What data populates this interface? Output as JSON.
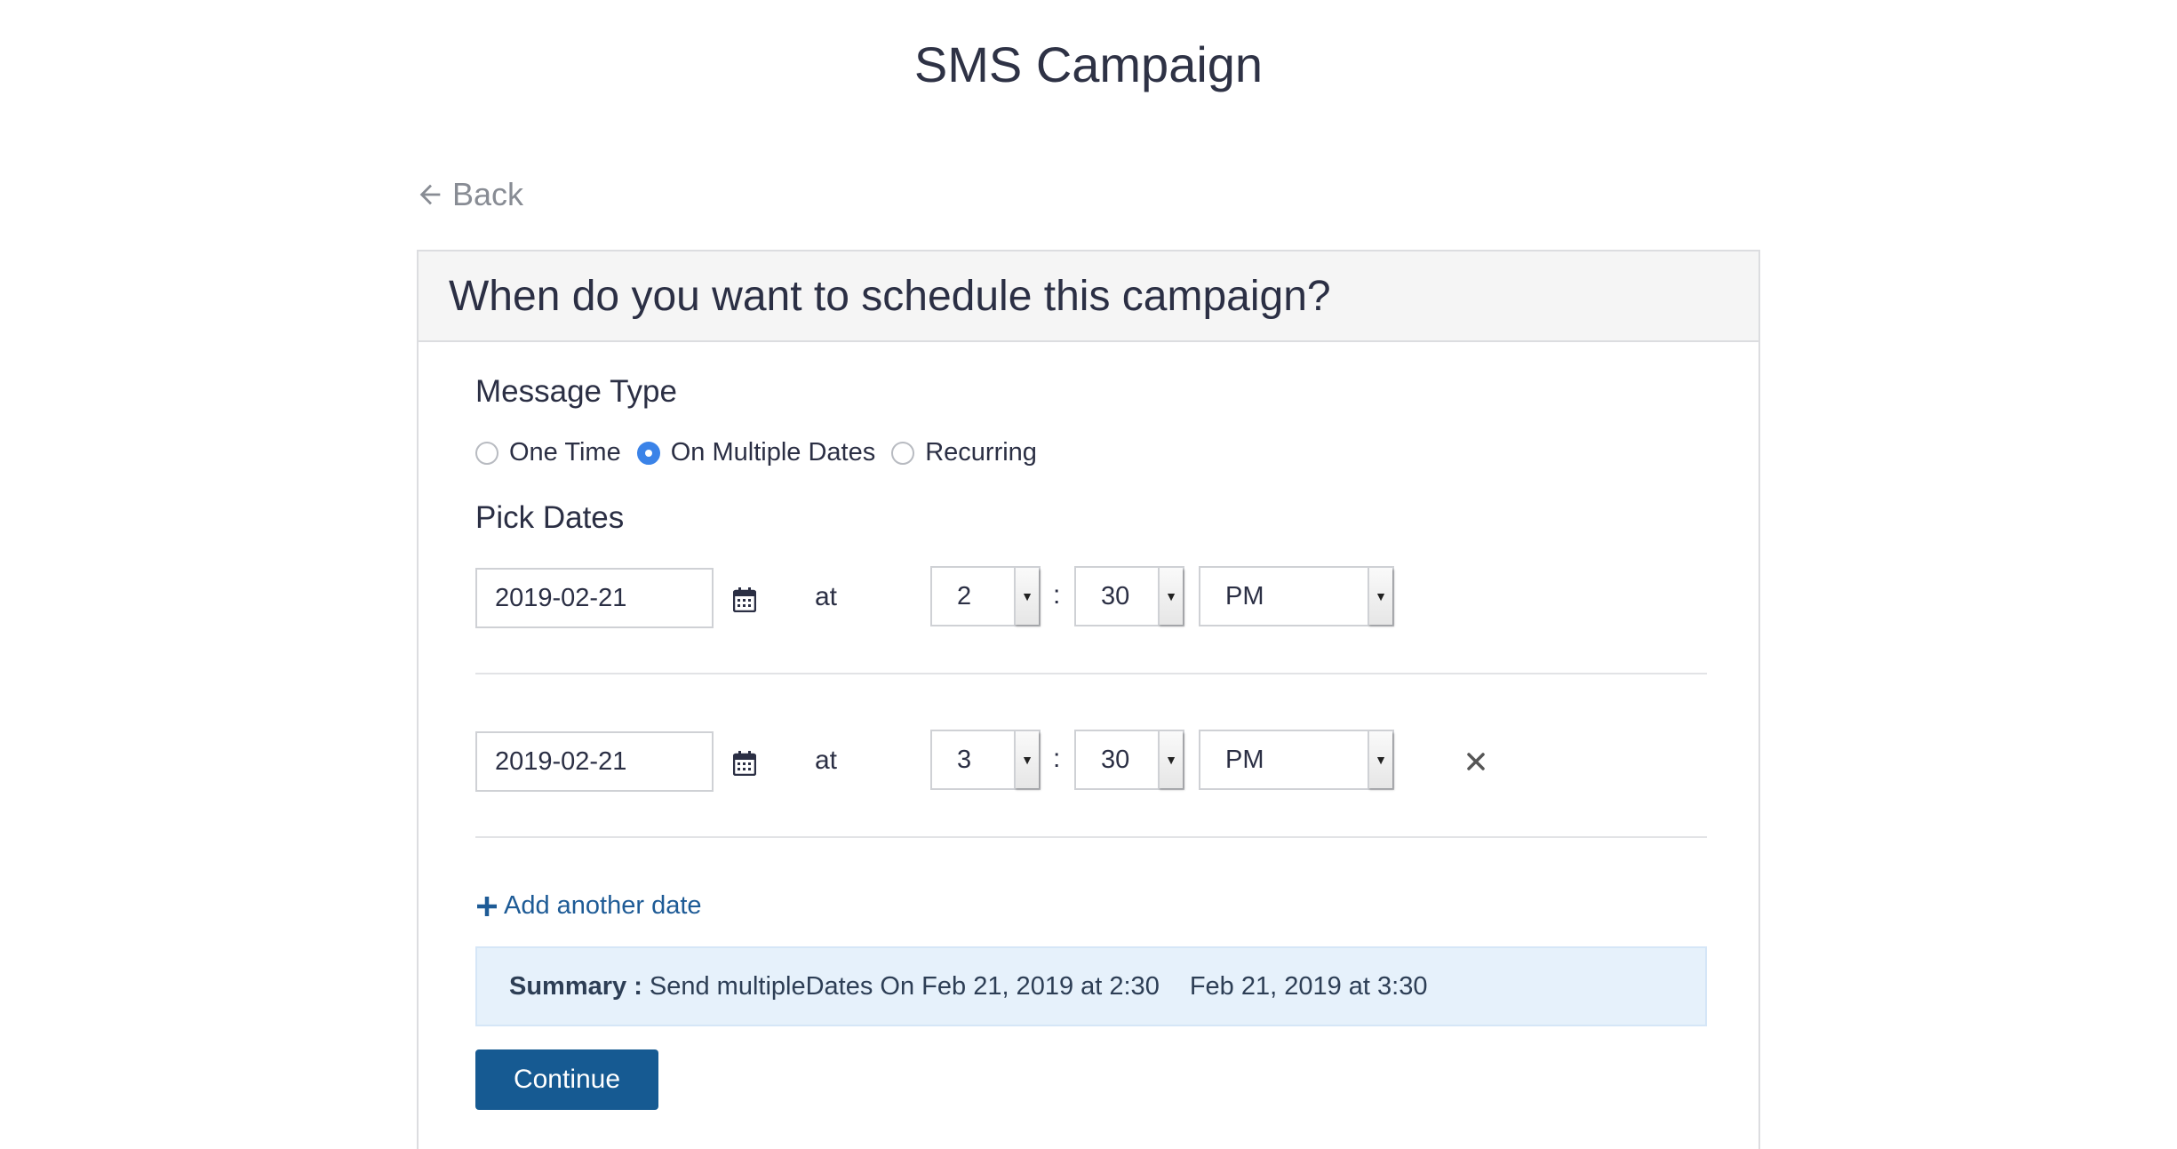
{
  "page": {
    "title": "SMS Campaign",
    "back_label": "Back"
  },
  "card": {
    "heading": "When do you want to schedule this campaign?"
  },
  "message_type": {
    "label": "Message Type",
    "options": [
      {
        "label": "One Time",
        "checked": false
      },
      {
        "label": "On Multiple Dates",
        "checked": true
      },
      {
        "label": "Recurring",
        "checked": false
      }
    ]
  },
  "pick_dates": {
    "label": "Pick Dates",
    "at_label": "at",
    "colon": ":",
    "rows": [
      {
        "date": "2019-02-21",
        "hour": "2",
        "minute": "30",
        "period": "PM",
        "removable": false
      },
      {
        "date": "2019-02-21",
        "hour": "3",
        "minute": "30",
        "period": "PM",
        "removable": true
      }
    ]
  },
  "add_date_label": "Add another date",
  "summary": {
    "label": "Summary :",
    "text": "Send multipleDates On Feb 21, 2019 at 2:30",
    "text2": "Feb 21, 2019 at 3:30"
  },
  "continue_label": "Continue",
  "colors": {
    "primary": "#165a92",
    "link": "#1e5b96",
    "radio_checked": "#3b83e8",
    "summary_bg": "#e6f1fb"
  }
}
